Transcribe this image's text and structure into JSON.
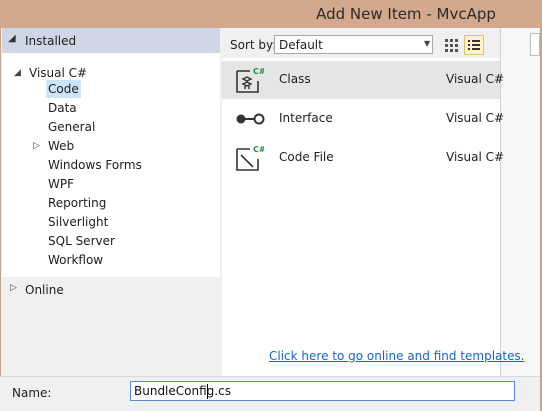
{
  "window": {
    "title": "Add New Item - MvcApp"
  },
  "left_pane": {
    "installed_label": "Installed",
    "tree": {
      "root": "Visual C#",
      "children": [
        "Code",
        "Data",
        "General",
        "Web",
        "Windows Forms",
        "WPF",
        "Reporting",
        "Silverlight",
        "SQL Server",
        "Workflow"
      ],
      "selected": "Code"
    },
    "online_label": "Online"
  },
  "toolbar": {
    "sort_label": "Sort by:",
    "sort_value": "Default",
    "icons": [
      "small-icons-view-icon",
      "list-view-icon"
    ]
  },
  "templates": [
    {
      "name": "Class",
      "type": "Visual C#",
      "icon": "class-file-icon",
      "badge": "C#"
    },
    {
      "name": "Interface",
      "type": "Visual C#",
      "icon": "interface-icon"
    },
    {
      "name": "Code File",
      "type": "Visual C#",
      "icon": "code-file-icon",
      "badge": "C#"
    }
  ],
  "online_link": "Click here to go online and find templates.",
  "name_field": {
    "label": "Name:",
    "value": "BundleConfig.cs"
  },
  "colors": {
    "title_bar": "#d4a88c",
    "installed_header": "#cfd6e5",
    "tree_selection": "#cce4f7",
    "row_selection": "#e5e5e5",
    "link": "#1e64c8",
    "badge_green": "#1e8f3e"
  }
}
